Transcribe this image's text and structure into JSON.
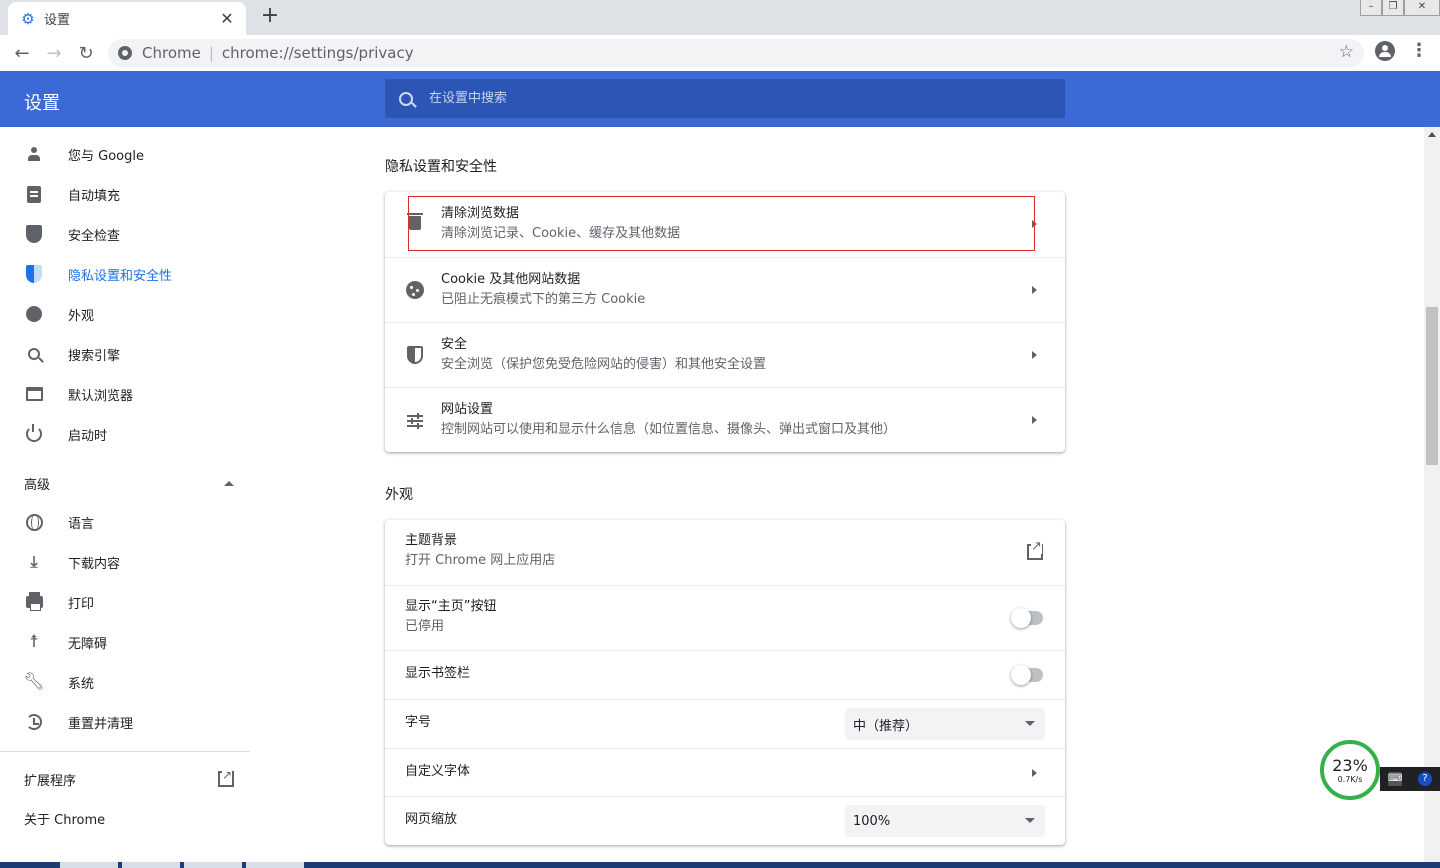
{
  "browser": {
    "tab_title": "设置",
    "chip": "Chrome",
    "url": "chrome://settings/privacy"
  },
  "header": {
    "title": "设置",
    "search_placeholder": "在设置中搜索"
  },
  "sidebar": {
    "items": [
      {
        "label": "您与 Google",
        "icon": "person-icon"
      },
      {
        "label": "自动填充",
        "icon": "clipboard-icon"
      },
      {
        "label": "安全检查",
        "icon": "shield-icon"
      },
      {
        "label": "隐私设置和安全性",
        "icon": "privacy-shield-icon"
      },
      {
        "label": "外观",
        "icon": "palette-icon"
      },
      {
        "label": "搜索引擎",
        "icon": "search-icon"
      },
      {
        "label": "默认浏览器",
        "icon": "browser-icon"
      },
      {
        "label": "启动时",
        "icon": "power-icon"
      }
    ],
    "advanced_label": "高级",
    "advanced_items": [
      {
        "label": "语言",
        "icon": "globe-icon"
      },
      {
        "label": "下载内容",
        "icon": "download-icon"
      },
      {
        "label": "打印",
        "icon": "print-icon"
      },
      {
        "label": "无障碍",
        "icon": "accessibility-icon"
      },
      {
        "label": "系统",
        "icon": "wrench-icon"
      },
      {
        "label": "重置并清理",
        "icon": "history-icon"
      }
    ],
    "extensions_label": "扩展程序",
    "about_label": "关于 Chrome",
    "active_color": "#1a73e8"
  },
  "privacy": {
    "title": "隐私设置和安全性",
    "rows": [
      {
        "primary": "清除浏览数据",
        "secondary": "清除浏览记录、Cookie、缓存及其他数据",
        "icon": "trash-icon"
      },
      {
        "primary": "Cookie 及其他网站数据",
        "secondary": "已阻止无痕模式下的第三方 Cookie",
        "icon": "cookie-icon"
      },
      {
        "primary": "安全",
        "secondary": "安全浏览（保护您免受危险网站的侵害）和其他安全设置",
        "icon": "security-shield-icon"
      },
      {
        "primary": "网站设置",
        "secondary": "控制网站可以使用和显示什么信息（如位置信息、摄像头、弹出式窗口及其他）",
        "icon": "tune-icon"
      }
    ]
  },
  "appearance": {
    "title": "外观",
    "theme_primary": "主题背景",
    "theme_secondary": "打开 Chrome 网上应用店",
    "home_primary": "显示“主页”按钮",
    "home_secondary": "已停用",
    "bookmarks_primary": "显示书签栏",
    "font_size_label": "字号",
    "font_size_value": "中（推荐）",
    "custom_fonts_label": "自定义字体",
    "zoom_label": "网页缩放",
    "zoom_value": "100%"
  },
  "net_widget": {
    "percent": "23%",
    "speed": "0.7K/s"
  },
  "colors": {
    "header": "#3b6ad6",
    "search_bg": "#2c55b5",
    "highlight": "#d93025"
  }
}
